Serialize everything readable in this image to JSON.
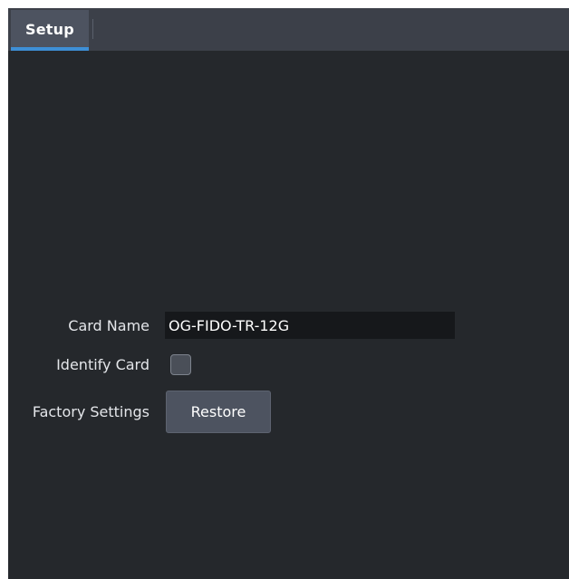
{
  "tabs": [
    {
      "label": "Setup",
      "active": true
    }
  ],
  "form": {
    "card_name": {
      "label": "Card Name",
      "value": "OG-FIDO-TR-12G"
    },
    "identify_card": {
      "label": "Identify Card",
      "checked": false
    },
    "factory_settings": {
      "label": "Factory Settings",
      "button_label": "Restore"
    }
  },
  "colors": {
    "background": "#25282c",
    "tabbar": "#3c4049",
    "active_tab": "#4d5360",
    "accent": "#3e8fd6",
    "field_background": "#16181b"
  }
}
